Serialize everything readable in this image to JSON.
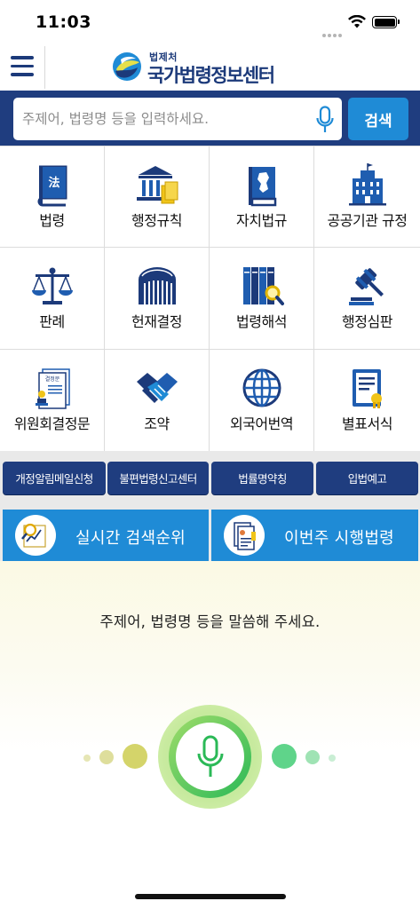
{
  "status_bar": {
    "time": "11:03"
  },
  "header": {
    "logo_sub": "법제처",
    "logo_title": "국가법령정보센터"
  },
  "search": {
    "placeholder": "주제어, 법령명 등을 입력하세요.",
    "button_label": "검색"
  },
  "grid": [
    {
      "label": "법령",
      "icon": "law-book-icon"
    },
    {
      "label": "행정규칙",
      "icon": "government-building-icon"
    },
    {
      "label": "자치법규",
      "icon": "korea-map-book-icon"
    },
    {
      "label": "공공기관 규정",
      "icon": "public-building-icon"
    },
    {
      "label": "판례",
      "icon": "scales-icon"
    },
    {
      "label": "헌재결정",
      "icon": "constitutional-court-icon"
    },
    {
      "label": "법령해석",
      "icon": "books-magnifier-icon"
    },
    {
      "label": "행정심판",
      "icon": "gavel-icon"
    },
    {
      "label": "위원회결정문",
      "icon": "decision-document-icon"
    },
    {
      "label": "조약",
      "icon": "handshake-icon"
    },
    {
      "label": "외국어번역",
      "icon": "globe-icon"
    },
    {
      "label": "별표서식",
      "icon": "form-document-icon"
    }
  ],
  "decision_doc_tag": "결정문",
  "quick_buttons": [
    "개정알림메일신청",
    "불편법령신고센터",
    "법률명약칭",
    "입법예고"
  ],
  "wide_buttons": [
    {
      "label": "실시간 검색순위",
      "icon": "search-ranking-icon"
    },
    {
      "label": "이번주 시행법령",
      "icon": "weekly-law-icon"
    }
  ],
  "voice": {
    "prompt": "주제어, 법령명 등을 말씀해 주세요."
  },
  "colors": {
    "navy": "#1f3d7f",
    "blue": "#1f8bd6",
    "green": "#2bb957",
    "olive": "#d4d46a"
  }
}
